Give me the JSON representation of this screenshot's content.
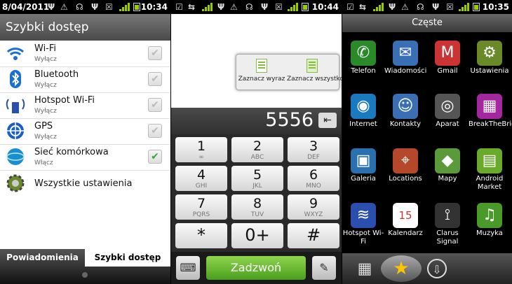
{
  "panel1": {
    "status": {
      "time": "10:34",
      "date": "8/04/2011"
    },
    "title": "Szybki dostęp",
    "items": [
      {
        "label": "Wi-Fi",
        "sub": "Wyłącz",
        "checked": false,
        "icon": "wifi-icon"
      },
      {
        "label": "Bluetooth",
        "sub": "Wyłącz",
        "checked": false,
        "icon": "bluetooth-icon"
      },
      {
        "label": "Hotspot Wi-Fi",
        "sub": "Wyłącz",
        "checked": false,
        "icon": "hotspot-icon"
      },
      {
        "label": "GPS",
        "sub": "Wyłącz",
        "checked": false,
        "icon": "gps-icon"
      },
      {
        "label": "Sieć komórkowa",
        "sub": "Włącz",
        "checked": true,
        "icon": "mobile-network-icon"
      }
    ],
    "all_settings": "Wszystkie ustawienia",
    "tabs": [
      "Powiadomienia",
      "Szybki dostęp"
    ]
  },
  "panel2": {
    "status": {
      "time": "10:44"
    },
    "popup": {
      "select_word": "Zaznacz wyraz",
      "select_all": "Zaznacz wszystko"
    },
    "number": "5556",
    "keys": [
      {
        "d": "1",
        "l": "∞"
      },
      {
        "d": "2",
        "l": "ABC"
      },
      {
        "d": "3",
        "l": "DEF"
      },
      {
        "d": "4",
        "l": "GHI"
      },
      {
        "d": "5",
        "l": "JKL"
      },
      {
        "d": "6",
        "l": "MNO"
      },
      {
        "d": "7",
        "l": "PQRS"
      },
      {
        "d": "8",
        "l": "TUV"
      },
      {
        "d": "9",
        "l": "WXYZ"
      },
      {
        "d": "*",
        "l": ""
      },
      {
        "d": "0+",
        "l": ""
      },
      {
        "d": "#",
        "l": ""
      }
    ],
    "call": "Zadzwoń"
  },
  "panel3": {
    "status": {
      "time": "10:35"
    },
    "title": "Częste",
    "apps": [
      {
        "label": "Telefon",
        "icon": "phone-icon",
        "glyph": "✆",
        "color": "#2a8a2a"
      },
      {
        "label": "Wiadomości",
        "icon": "messages-icon",
        "glyph": "✉",
        "color": "#3a6fb5"
      },
      {
        "label": "Gmail",
        "icon": "gmail-icon",
        "glyph": "M",
        "color": "#c33"
      },
      {
        "label": "Ustawienia",
        "icon": "settings-icon",
        "glyph": "⚙",
        "color": "#6a8a2a"
      },
      {
        "label": "Internet",
        "icon": "globe-icon",
        "glyph": "◉",
        "color": "#1a7abf"
      },
      {
        "label": "Kontakty",
        "icon": "contacts-icon",
        "glyph": "☺",
        "color": "#3a6fb5"
      },
      {
        "label": "Aparat",
        "icon": "camera-icon",
        "glyph": "◎",
        "color": "#555"
      },
      {
        "label": "BreakTheBricks",
        "icon": "breakthebricks-icon",
        "glyph": "▦",
        "color": "#a3289f"
      },
      {
        "label": "Galeria",
        "icon": "gallery-icon",
        "glyph": "▣",
        "color": "#2a6faf"
      },
      {
        "label": "Locations",
        "icon": "locations-icon",
        "glyph": "⌖",
        "color": "#b5472a"
      },
      {
        "label": "Mapy",
        "icon": "maps-icon",
        "glyph": "◆",
        "color": "#5a9a3a"
      },
      {
        "label": "Android Market",
        "icon": "market-icon",
        "glyph": "▤",
        "color": "#6aaa2a"
      },
      {
        "label": "Hotspot Wi-Fi",
        "icon": "hotspot-icon",
        "glyph": "≋",
        "color": "#2a4faf"
      },
      {
        "label": "Kalendarz",
        "icon": "calendar-icon",
        "glyph": "15",
        "color": "#c33"
      },
      {
        "label": "Clarus Signal",
        "icon": "signal-tower-icon",
        "glyph": "⟟",
        "color": "#333"
      },
      {
        "label": "Muzyka",
        "icon": "music-icon",
        "glyph": "♫",
        "color": "#4a9a2a"
      }
    ]
  }
}
